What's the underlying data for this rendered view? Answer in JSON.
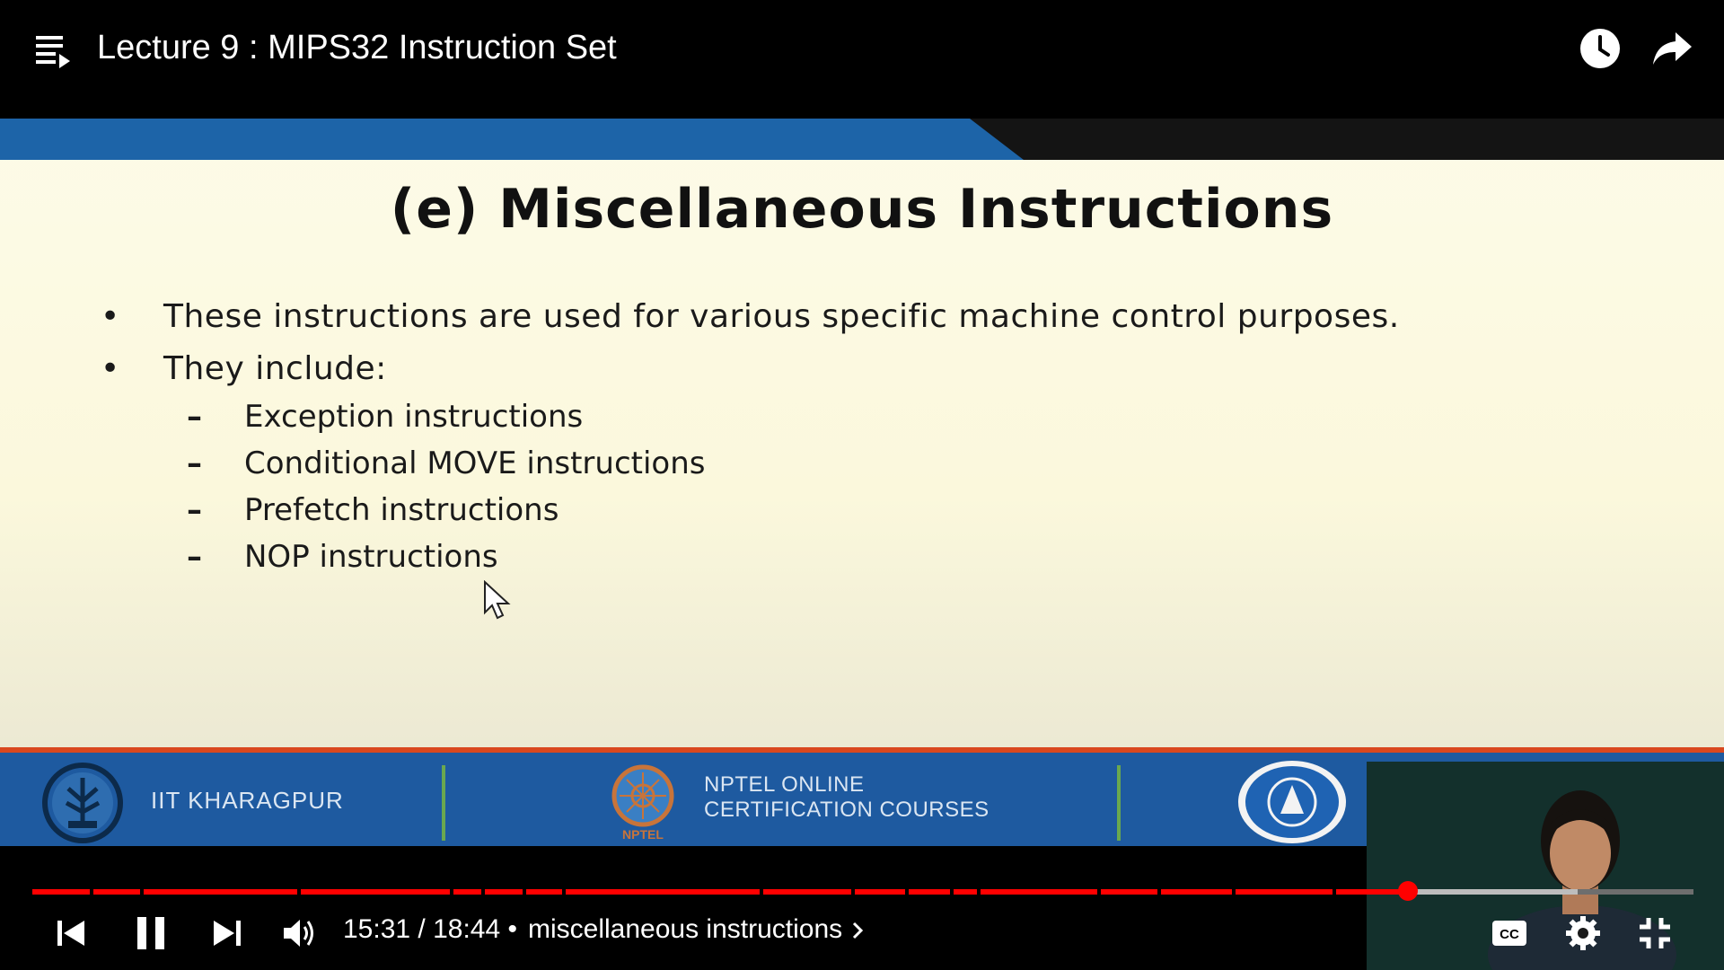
{
  "player": {
    "title": "Lecture 9 : MIPS32 Instruction Set",
    "time_display": "15:31 / 18:44 •",
    "chapter": "miscellaneous instructions",
    "progress_fraction": 0.828,
    "played_color": "#ff0000",
    "buffered_color": "#bdbdbd",
    "unbuffered_color": "#6e6e6e"
  },
  "slide": {
    "title": "(e) Miscellaneous Instructions",
    "bullets": [
      "These instructions are used for various specific machine control purposes.",
      "They include:"
    ],
    "sub_items": [
      "Exception instructions",
      "Conditional MOVE instructions",
      "Prefetch instructions",
      "NOP instructions"
    ],
    "bullet_symbol": "•",
    "sub_symbol": "–",
    "footer": {
      "left_label": "IIT KHARAGPUR",
      "center_label_line1": "NPTEL ONLINE",
      "center_label_line2": "CERTIFICATION COURSES",
      "nptel_logo_text": "NPTEL"
    }
  },
  "icons": {
    "playlist": "playlist-icon",
    "watch_later": "clock-icon",
    "share": "share-icon",
    "prev": "skip-previous-icon",
    "pause": "pause-icon",
    "next": "skip-next-icon",
    "volume": "volume-icon",
    "chapter_chevron": "chevron-right-icon",
    "captions": "captions-icon",
    "settings": "gear-icon",
    "exit_fullscreen": "exit-fullscreen-icon"
  },
  "captions_label": "CC"
}
